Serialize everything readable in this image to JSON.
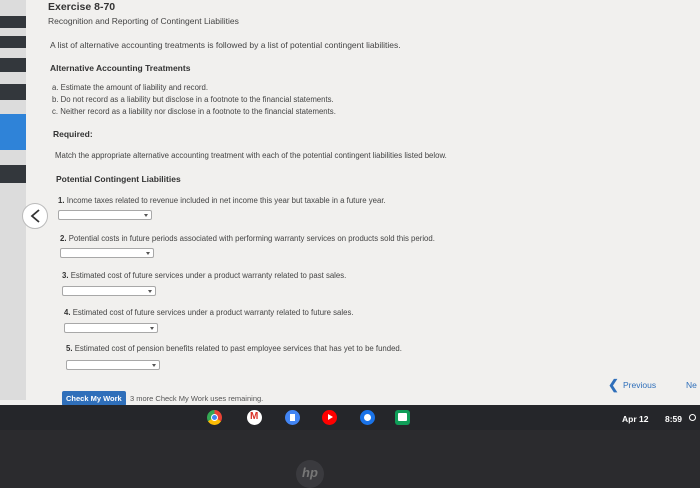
{
  "exercise": {
    "title": "Exercise 8-70",
    "subtitle": "Recognition and Reporting of Contingent Liabilities",
    "intro": "A list of alternative accounting treatments is followed by a list of potential contingent liabilities."
  },
  "alternatives": {
    "heading": "Alternative Accounting Treatments",
    "items": [
      "a. Estimate the amount of liability and record.",
      "b. Do not record as a liability but disclose in a footnote to the financial statements.",
      "c. Neither record as a liability nor disclose in a footnote to the financial statements."
    ]
  },
  "required": {
    "heading": "Required:",
    "text": "Match the appropriate alternative accounting treatment with each of the potential contingent liabilities listed below."
  },
  "liabilities": {
    "heading": "Potential Contingent Liabilities",
    "items": [
      {
        "num": "1.",
        "text": "Income taxes related to revenue included in net income this year but taxable in a future year.",
        "selected": ""
      },
      {
        "num": "2.",
        "text": "Potential costs in future periods associated with performing warranty services on products sold this period.",
        "selected": ""
      },
      {
        "num": "3.",
        "text": "Estimated cost of future services under a product warranty related to past sales.",
        "selected": ""
      },
      {
        "num": "4.",
        "text": "Estimated cost of future services under a product warranty related to future sales.",
        "selected": ""
      },
      {
        "num": "5.",
        "text": "Estimated cost of pension benefits related to past employee services that has yet to be funded.",
        "selected": ""
      }
    ]
  },
  "footer": {
    "check_button": "Check My Work",
    "check_note": "3 more Check My Work uses remaining.",
    "previous": "Previous",
    "next": "Ne"
  },
  "taskbar": {
    "apps": [
      "chrome-icon",
      "gmail-icon",
      "docs-icon",
      "youtube-icon",
      "chat-icon",
      "classroom-icon"
    ],
    "date": "Apr 12",
    "time": "8:59"
  },
  "device": {
    "logo": "hp"
  }
}
